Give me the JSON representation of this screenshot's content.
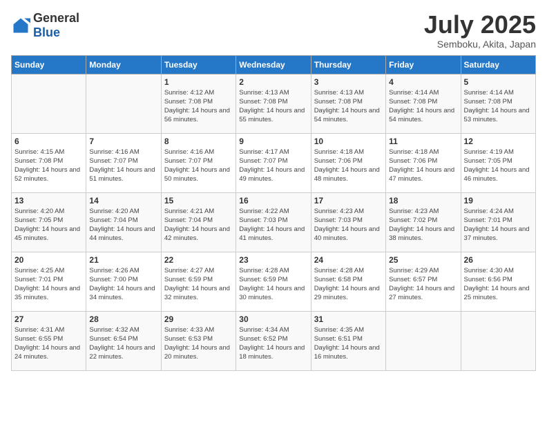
{
  "header": {
    "logo_general": "General",
    "logo_blue": "Blue",
    "title": "July 2025",
    "location": "Semboku, Akita, Japan"
  },
  "days_of_week": [
    "Sunday",
    "Monday",
    "Tuesday",
    "Wednesday",
    "Thursday",
    "Friday",
    "Saturday"
  ],
  "weeks": [
    [
      {
        "day": "",
        "info": ""
      },
      {
        "day": "",
        "info": ""
      },
      {
        "day": "1",
        "info": "Sunrise: 4:12 AM\nSunset: 7:08 PM\nDaylight: 14 hours and 56 minutes."
      },
      {
        "day": "2",
        "info": "Sunrise: 4:13 AM\nSunset: 7:08 PM\nDaylight: 14 hours and 55 minutes."
      },
      {
        "day": "3",
        "info": "Sunrise: 4:13 AM\nSunset: 7:08 PM\nDaylight: 14 hours and 54 minutes."
      },
      {
        "day": "4",
        "info": "Sunrise: 4:14 AM\nSunset: 7:08 PM\nDaylight: 14 hours and 54 minutes."
      },
      {
        "day": "5",
        "info": "Sunrise: 4:14 AM\nSunset: 7:08 PM\nDaylight: 14 hours and 53 minutes."
      }
    ],
    [
      {
        "day": "6",
        "info": "Sunrise: 4:15 AM\nSunset: 7:08 PM\nDaylight: 14 hours and 52 minutes."
      },
      {
        "day": "7",
        "info": "Sunrise: 4:16 AM\nSunset: 7:07 PM\nDaylight: 14 hours and 51 minutes."
      },
      {
        "day": "8",
        "info": "Sunrise: 4:16 AM\nSunset: 7:07 PM\nDaylight: 14 hours and 50 minutes."
      },
      {
        "day": "9",
        "info": "Sunrise: 4:17 AM\nSunset: 7:07 PM\nDaylight: 14 hours and 49 minutes."
      },
      {
        "day": "10",
        "info": "Sunrise: 4:18 AM\nSunset: 7:06 PM\nDaylight: 14 hours and 48 minutes."
      },
      {
        "day": "11",
        "info": "Sunrise: 4:18 AM\nSunset: 7:06 PM\nDaylight: 14 hours and 47 minutes."
      },
      {
        "day": "12",
        "info": "Sunrise: 4:19 AM\nSunset: 7:05 PM\nDaylight: 14 hours and 46 minutes."
      }
    ],
    [
      {
        "day": "13",
        "info": "Sunrise: 4:20 AM\nSunset: 7:05 PM\nDaylight: 14 hours and 45 minutes."
      },
      {
        "day": "14",
        "info": "Sunrise: 4:20 AM\nSunset: 7:04 PM\nDaylight: 14 hours and 44 minutes."
      },
      {
        "day": "15",
        "info": "Sunrise: 4:21 AM\nSunset: 7:04 PM\nDaylight: 14 hours and 42 minutes."
      },
      {
        "day": "16",
        "info": "Sunrise: 4:22 AM\nSunset: 7:03 PM\nDaylight: 14 hours and 41 minutes."
      },
      {
        "day": "17",
        "info": "Sunrise: 4:23 AM\nSunset: 7:03 PM\nDaylight: 14 hours and 40 minutes."
      },
      {
        "day": "18",
        "info": "Sunrise: 4:23 AM\nSunset: 7:02 PM\nDaylight: 14 hours and 38 minutes."
      },
      {
        "day": "19",
        "info": "Sunrise: 4:24 AM\nSunset: 7:01 PM\nDaylight: 14 hours and 37 minutes."
      }
    ],
    [
      {
        "day": "20",
        "info": "Sunrise: 4:25 AM\nSunset: 7:01 PM\nDaylight: 14 hours and 35 minutes."
      },
      {
        "day": "21",
        "info": "Sunrise: 4:26 AM\nSunset: 7:00 PM\nDaylight: 14 hours and 34 minutes."
      },
      {
        "day": "22",
        "info": "Sunrise: 4:27 AM\nSunset: 6:59 PM\nDaylight: 14 hours and 32 minutes."
      },
      {
        "day": "23",
        "info": "Sunrise: 4:28 AM\nSunset: 6:59 PM\nDaylight: 14 hours and 30 minutes."
      },
      {
        "day": "24",
        "info": "Sunrise: 4:28 AM\nSunset: 6:58 PM\nDaylight: 14 hours and 29 minutes."
      },
      {
        "day": "25",
        "info": "Sunrise: 4:29 AM\nSunset: 6:57 PM\nDaylight: 14 hours and 27 minutes."
      },
      {
        "day": "26",
        "info": "Sunrise: 4:30 AM\nSunset: 6:56 PM\nDaylight: 14 hours and 25 minutes."
      }
    ],
    [
      {
        "day": "27",
        "info": "Sunrise: 4:31 AM\nSunset: 6:55 PM\nDaylight: 14 hours and 24 minutes."
      },
      {
        "day": "28",
        "info": "Sunrise: 4:32 AM\nSunset: 6:54 PM\nDaylight: 14 hours and 22 minutes."
      },
      {
        "day": "29",
        "info": "Sunrise: 4:33 AM\nSunset: 6:53 PM\nDaylight: 14 hours and 20 minutes."
      },
      {
        "day": "30",
        "info": "Sunrise: 4:34 AM\nSunset: 6:52 PM\nDaylight: 14 hours and 18 minutes."
      },
      {
        "day": "31",
        "info": "Sunrise: 4:35 AM\nSunset: 6:51 PM\nDaylight: 14 hours and 16 minutes."
      },
      {
        "day": "",
        "info": ""
      },
      {
        "day": "",
        "info": ""
      }
    ]
  ]
}
